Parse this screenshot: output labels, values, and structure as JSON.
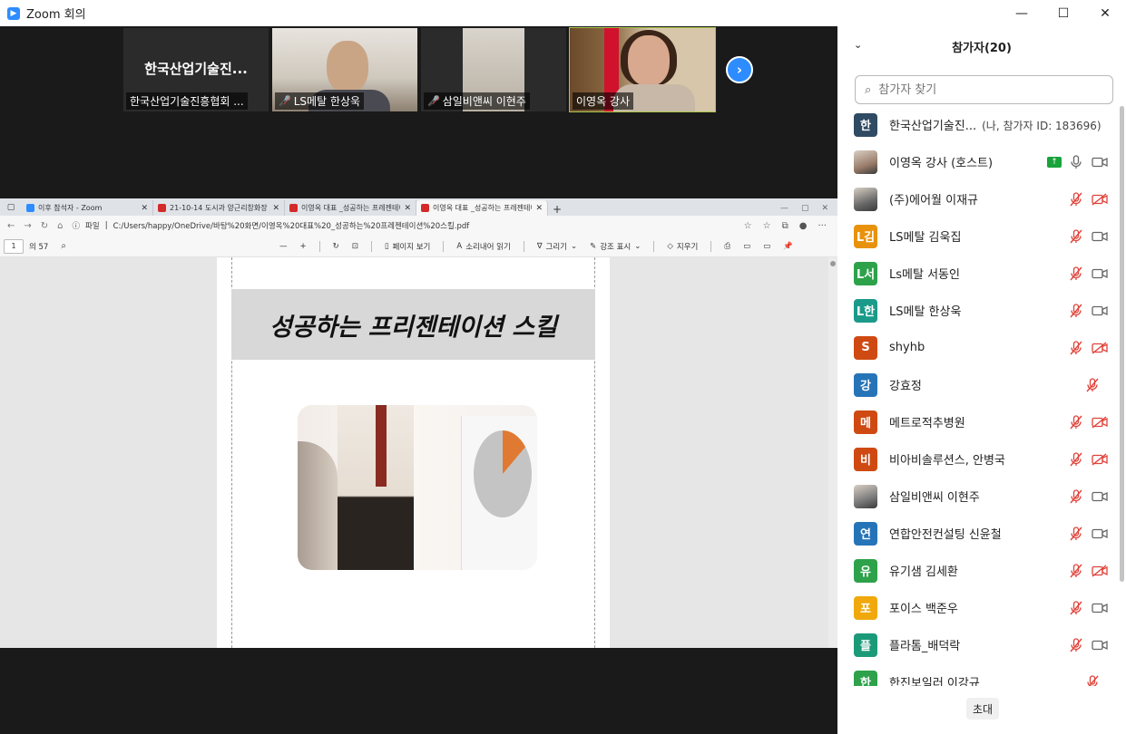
{
  "window": {
    "title": "Zoom 회의",
    "min": "—",
    "max": "☐",
    "close": "✕"
  },
  "video_strip": {
    "tiles": [
      {
        "big_name": "한국산업기술진...",
        "label": "한국산업기술진흥협회 ..."
      },
      {
        "label": "LS메탈 한상욱"
      },
      {
        "label": "삼일비앤씨 이현주"
      },
      {
        "label": "이영옥 강사"
      }
    ]
  },
  "browser": {
    "tabs": [
      {
        "label": "이후 참석자 - Zoom",
        "color": "#2d8cff"
      },
      {
        "label": "21-10-14 도시과 양근리창화장 회의",
        "color": "#d42a2a"
      },
      {
        "label": "이영옥 대표 _성공하는 프레젠테이션",
        "color": "#d42a2a"
      },
      {
        "label": "이영옥 대표 _성공하는 프레젠테이",
        "color": "#d42a2a"
      }
    ],
    "address": {
      "scheme": "파일",
      "url": "C:/Users/happy/OneDrive/바탕%20화면/이영옥%20대표%20_성공하는%20프레젠테이션%20스킬.pdf"
    },
    "pdf_toolbar": {
      "page": "1",
      "of": "의 57",
      "page_view": "페이지 보기",
      "read_aloud": "소리내어 읽기",
      "draw": "그리기",
      "highlight": "강조 표시",
      "erase": "지우기"
    },
    "slide_title": "성공하는 프리젠테이션 스킬"
  },
  "panel": {
    "title": "참가자(20)",
    "search_placeholder": "참가자 찾기",
    "invite": "초대",
    "participants": [
      {
        "initial": "한",
        "name": "한국산업기술진...",
        "me": "(나, 참가자 ID: 183696)",
        "color": "#2f4a63",
        "mic": "none",
        "video": "none"
      },
      {
        "initial": "",
        "name": "이영옥 강사 (호스트)",
        "color": "#9b7d6a",
        "photo": true,
        "share": true,
        "mic": "on",
        "video": "on"
      },
      {
        "initial": "",
        "name": "(주)에어월  이재규",
        "color": "#6a6a6a",
        "photo": true,
        "mic": "off",
        "video": "off"
      },
      {
        "initial": "L김",
        "name": "LS메탈 김욱집",
        "color": "#e8920c",
        "mic": "off",
        "video": "on"
      },
      {
        "initial": "L서",
        "name": "Ls메탈 서동인",
        "color": "#2da24a",
        "mic": "off",
        "video": "on"
      },
      {
        "initial": "L한",
        "name": "LS메탈 한상욱",
        "color": "#1b9a8a",
        "mic": "off",
        "video": "on"
      },
      {
        "initial": "S",
        "name": "shyhb",
        "color": "#cf4a12",
        "mic": "off",
        "video": "off"
      },
      {
        "initial": "강",
        "name": "강효정",
        "color": "#2674b8",
        "mic": "off",
        "video": "none"
      },
      {
        "initial": "메",
        "name": "메트로적추병원",
        "color": "#cf4a12",
        "mic": "off",
        "video": "off"
      },
      {
        "initial": "비",
        "name": "비아비솔루션스, 안병국",
        "color": "#cf4a12",
        "mic": "off",
        "video": "off"
      },
      {
        "initial": "",
        "name": "삼일비앤씨 이현주",
        "color": "#7a7a7a",
        "photo": true,
        "mic": "off",
        "video": "on"
      },
      {
        "initial": "연",
        "name": "연합안전컨설팅 신윤철",
        "color": "#2674b8",
        "mic": "off",
        "video": "on"
      },
      {
        "initial": "유",
        "name": "유기샘 김세환",
        "color": "#2da24a",
        "mic": "off",
        "video": "off"
      },
      {
        "initial": "포",
        "name": "포이스 백준우",
        "color": "#f0a80c",
        "mic": "off",
        "video": "on"
      },
      {
        "initial": "플",
        "name": "플라톰_배덕락",
        "color": "#1b9a7a",
        "mic": "off",
        "video": "on"
      },
      {
        "initial": "한",
        "name": "한진보일러 이강규",
        "color": "#2da24a",
        "mic": "off",
        "video": "none"
      }
    ]
  },
  "icons": {
    "mic_off_color": "#e0423a",
    "mic_on_color": "#666666",
    "video_on_color": "#666666",
    "video_off_color": "#e0423a"
  }
}
